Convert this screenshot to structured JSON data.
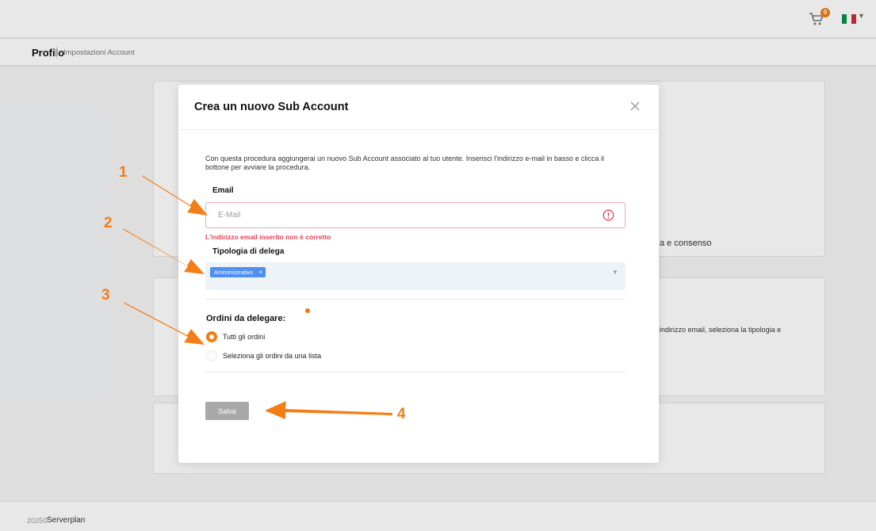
{
  "topbar": {
    "cart_badge": "0",
    "flag_colors": [
      "#009246",
      "#ffffff",
      "#ce2b37"
    ]
  },
  "header": {
    "title": "Profilo",
    "breadcrumb": "Impostazioni Account"
  },
  "background": {
    "text_1": "a e consenso",
    "text_2": "indirizzo email, seleziona la tipologia e"
  },
  "modal": {
    "title": "Crea un nuovo Sub Account",
    "intro": "Con questa procedura aggiungerai un nuovo Sub Account associato al tuo utente. Inserisci l'indirizzo e-mail in basso e clicca il bottone per avviare la procedura.",
    "email": {
      "label": "Email",
      "placeholder": "E-Mail",
      "value": "",
      "error": "L'indirizzo email inserito non è corretto"
    },
    "delega": {
      "label": "Tipologia di delega",
      "selected_tag": "Amministrativo",
      "tag_remove": "×"
    },
    "ordini": {
      "label": "Ordini da delegare:",
      "options": [
        {
          "label": "Tutti gli ordini",
          "checked": true
        },
        {
          "label": "Seleziona gli ordini da una lista",
          "checked": false
        }
      ]
    },
    "save_label": "Salva"
  },
  "annotations": {
    "steps": [
      "1",
      "2",
      "3",
      "4"
    ],
    "color": "#f47e15"
  },
  "footer": {
    "copyright": "2025©",
    "brand": "Serverplan"
  },
  "colors": {
    "accent": "#f07c12",
    "error": "#e04255",
    "tag": "#4f8ff0",
    "save_disabled": "#a9a9a9"
  },
  "icons": [
    "cart-icon",
    "flag-icon",
    "close-icon",
    "error-icon",
    "chevron-down-icon"
  ]
}
